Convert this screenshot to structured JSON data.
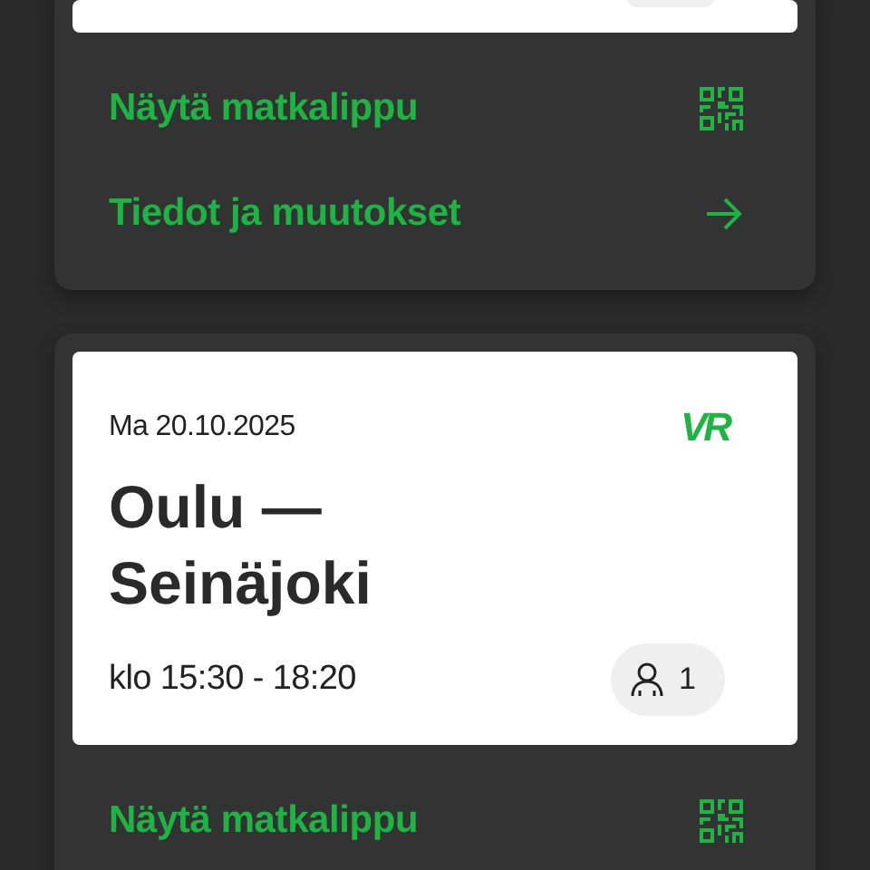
{
  "trips": [
    {
      "partial": true,
      "actions": [
        {
          "label": "Näytä matkalippu",
          "kind": "qr"
        },
        {
          "label": "Tiedot ja muutokset",
          "kind": "arrow"
        }
      ]
    },
    {
      "partial": false,
      "date": "Ma 20.10.2025",
      "logo": "VR",
      "route": "Oulu — Seinäjoki",
      "time": "klo 15:30 - 18:20",
      "passengers": "1",
      "actions": [
        {
          "label": "Näytä matkalippu",
          "kind": "qr"
        }
      ]
    }
  ]
}
